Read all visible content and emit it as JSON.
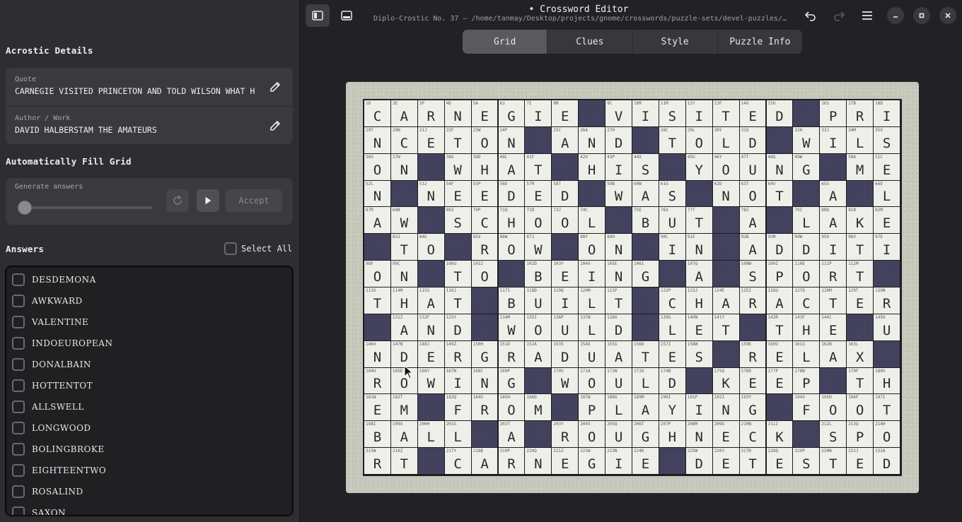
{
  "sidebar": {
    "acrostic_title": "Acrostic Details",
    "quote_label": "Quote",
    "quote_value": "CARNEGIE VISITED PRINCETON AND TOLD WILSON WHAT HIS YOUNG MEN NEEDED WAS NOT A LAW SCHOOL BUT A LAKE",
    "author_label": "Author / Work",
    "author_value": "DAVID HALBERSTAM THE AMATEURS",
    "autofill_title": "Automatically Fill Grid",
    "generate_label": "Generate answers",
    "generate_progress": 0,
    "accept_label": "Accept",
    "answers_title": "Answers",
    "select_all_label": "Select All",
    "answers": [
      "Desdemona",
      "Awkward",
      "Valentine",
      "Indoeuropean",
      "Donalbain",
      "Hottentot",
      "Allswell",
      "Longwood",
      "Bolingbroke",
      "Eighteentwo",
      "Rosalind",
      "Saxon"
    ]
  },
  "header": {
    "title": "• Crossword Editor",
    "subtitle": "Diplo-Crostic No. 37 — /home/tanmay/Desktop/projects/gnome/crosswords/puzzle-sets/devel-puzzles/…",
    "icons": [
      "sidebar-toggle-icon",
      "bottom-panel-icon",
      "undo-icon",
      "redo-icon",
      "menu-icon",
      "minimize-icon",
      "maximize-icon",
      "close-icon"
    ]
  },
  "tabs": [
    {
      "label": "Grid",
      "active": true
    },
    {
      "label": "Clues",
      "active": false
    },
    {
      "label": "Style",
      "active": false
    },
    {
      "label": "Puzzle Info",
      "active": false
    }
  ],
  "grid": {
    "cols": 20,
    "rows": 14,
    "letters": [
      "CARNEGIE#VISITED#PRI",
      "NCETON#AND#TOLD#WILS",
      "ON#WHAT#HIS#YOUNG#ME",
      "N#NEEDED#WAS#NOT#A#L",
      "AW#SCHOOL#BUT#A#LAKE",
      "#TO#ROW#ON#IN#ADDITI",
      "ON#TO#BEING#A#SPORT#",
      "THAT#BUILT#CHARACTER",
      "#AND#WOULD#LET#THE#U",
      "NDERGRADUATES#RELAX#",
      "ROWING#WOULD#KEEP#TH",
      "EM#FROM#PLAYING#FOOT",
      "BALL#A#ROUGHNECK#SPO",
      "RT#CARNEGIE#DETESTED"
    ],
    "clue_labels": [
      [
        "1D",
        "2E",
        "3P",
        "4D",
        "5A",
        "6J",
        "7I",
        "8M",
        "",
        "9C",
        "10R",
        "11M",
        "12Y",
        "13F",
        "14O",
        "15U",
        "",
        "16S",
        "17B",
        "18D"
      ],
      [
        "19T",
        "20N",
        "21J",
        "22F",
        "23W",
        "24P",
        "",
        "25C",
        "26A",
        "27H",
        "",
        "28C",
        "29L",
        "30Y",
        "31O",
        "",
        "32H",
        "33J",
        "34M",
        "35X"
      ],
      [
        "36S",
        "37W",
        "",
        "38G",
        "39D",
        "40L",
        "41F",
        "",
        "42V",
        "43P",
        "44X",
        "",
        "45U",
        "46Y",
        "47T",
        "48Q",
        "49W",
        "",
        "50A",
        "51C"
      ],
      [
        "52L",
        "",
        "53J",
        "54F",
        "55P",
        "56E",
        "57R",
        "58T",
        "",
        "59B",
        "60W",
        "61G",
        "",
        "62D",
        "63T",
        "64V",
        "",
        "65S",
        "",
        "66E"
      ],
      [
        "67R",
        "68B",
        "",
        "69Z",
        "70P",
        "71Q",
        "72D",
        "73J",
        "74C",
        "",
        "75E",
        "76X",
        "77T",
        "",
        "78Z",
        "",
        "79I",
        "80D",
        "81B",
        "82M"
      ],
      [
        "",
        "83J",
        "84U",
        "",
        "85X",
        "86W",
        "87J",
        "",
        "88Y",
        "89H",
        "",
        "90C",
        "91E",
        "",
        "92B",
        "93M",
        "94W",
        "95U",
        "96V",
        "97E"
      ],
      [
        "98F",
        "99C",
        "",
        "100U",
        "101I",
        "",
        "102D",
        "103Y",
        "104V",
        "105E",
        "106I",
        "",
        "107Q",
        "",
        "108W",
        "109Z",
        "110E",
        "111P",
        "112M",
        ""
      ],
      [
        "113S",
        "114M",
        "115S",
        "116J",
        "",
        "117I",
        "118D",
        "119Q",
        "120M",
        "121P",
        "",
        "122P",
        "123J",
        "124E",
        "125I",
        "126U",
        "127Q",
        "128M",
        "129T",
        "130N"
      ],
      [
        "",
        "131Z",
        "132F",
        "133Y",
        "",
        "134M",
        "135I",
        "136P",
        "137W",
        "138X",
        "",
        "139G",
        "140N",
        "141Y",
        "",
        "142R",
        "143F",
        "144C",
        "",
        "145U"
      ],
      [
        "146V",
        "147N",
        "148J",
        "149Z",
        "150H",
        "151D",
        "152A",
        "153S",
        "154X",
        "155G",
        "156D",
        "157I",
        "158W",
        "",
        "159K",
        "160U",
        "161G",
        "162N",
        "163L",
        ""
      ],
      [
        "164U",
        "165D",
        "166Y",
        "167N",
        "168C",
        "169P",
        "",
        "170V",
        "171A",
        "172W",
        "173X",
        "174B",
        "",
        "175Q",
        "176D",
        "177P",
        "178W",
        "",
        "179F",
        "180V"
      ],
      [
        "181W",
        "182T",
        "",
        "183Q",
        "184S",
        "185H",
        "186D",
        "",
        "187W",
        "188G",
        "189M",
        "190I",
        "191P",
        "192I",
        "193Y",
        "",
        "194V",
        "195H",
        "196F",
        "197I"
      ],
      [
        "198I",
        "199X",
        "200H",
        "201G",
        "",
        "202T",
        "",
        "203Y",
        "204V",
        "205Q",
        "206T",
        "207P",
        "208M",
        "209G",
        "210N",
        "211Z",
        "",
        "212L",
        "213Q",
        "214H"
      ],
      [
        "215W",
        "216Z",
        "",
        "217Y",
        "218B",
        "219P",
        "220Q",
        "221Z",
        "222W",
        "223N",
        "224K",
        "",
        "225W",
        "226Y",
        "227R",
        "228Q",
        "229P",
        "230N",
        "231J",
        "232A"
      ]
    ]
  }
}
